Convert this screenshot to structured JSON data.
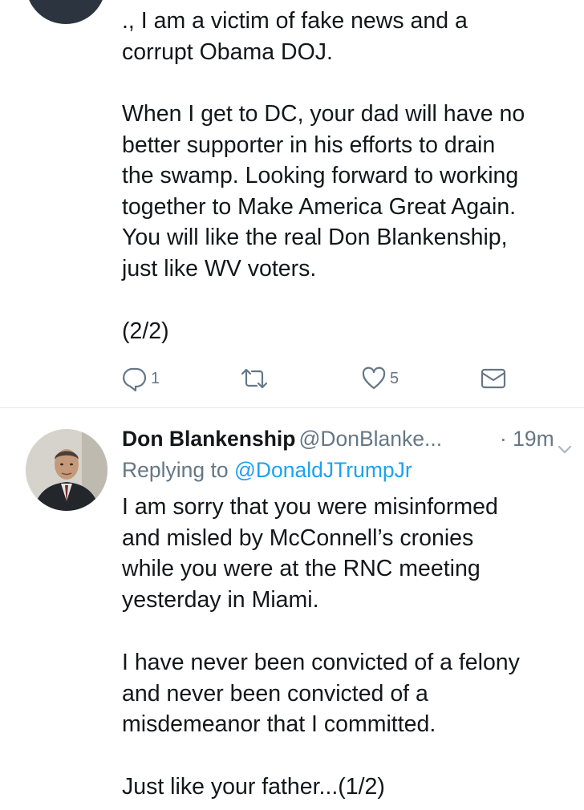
{
  "tweet_top": {
    "text_line1": "., I am a victim of fake news and a\ncorrupt Obama DOJ.",
    "text_para2": "When I get to DC, your dad will have no\nbetter supporter in his efforts to drain\nthe swamp. Looking forward to working\ntogether to Make America Great Again.\nYou will like the real Don Blankenship,\njust like WV voters.",
    "text_sig": "(2/2)",
    "actions": {
      "reply_icon": "reply-icon",
      "reply_count": "1",
      "retweet_icon": "retweet-icon",
      "like_icon": "heart-icon",
      "like_count": "5",
      "dm_icon": "envelope-icon"
    }
  },
  "tweet_bottom": {
    "name": "Don Blankenship",
    "handle": "@DonBlanke...",
    "time": "· 19m",
    "replying_prefix": "Replying to ",
    "replying_to": "@DonaldJTrumpJr",
    "text_para1": "I am sorry that you were misinformed\nand misled by McConnell’s cronies\nwhile you were at the RNC meeting\nyesterday in Miami.",
    "text_para2": "I have never been convicted of a felony\nand never been convicted of a\nmisdemeanor that I committed.",
    "text_para3": "Just like your father...(1/2)"
  },
  "colors": {
    "text": "#14171a",
    "secondary": "#657786",
    "link": "#1da1f2",
    "divider": "#e1e8ed"
  }
}
